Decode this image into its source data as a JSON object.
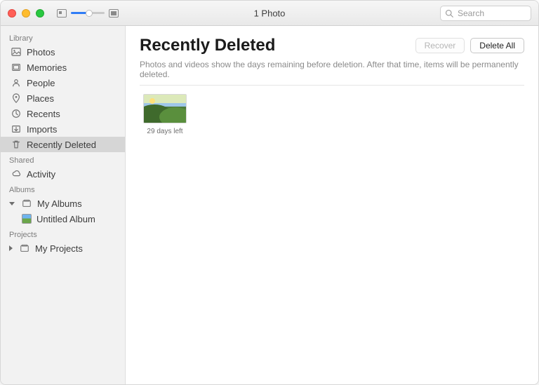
{
  "window": {
    "title": "1 Photo"
  },
  "search": {
    "placeholder": "Search"
  },
  "sidebar": {
    "sections": {
      "library": {
        "header": "Library",
        "items": [
          {
            "label": "Photos"
          },
          {
            "label": "Memories"
          },
          {
            "label": "People"
          },
          {
            "label": "Places"
          },
          {
            "label": "Recents"
          },
          {
            "label": "Imports"
          },
          {
            "label": "Recently Deleted"
          }
        ]
      },
      "shared": {
        "header": "Shared",
        "items": [
          {
            "label": "Activity"
          }
        ]
      },
      "albums": {
        "header": "Albums",
        "items": [
          {
            "label": "My Albums"
          },
          {
            "label": "Untitled Album"
          }
        ]
      },
      "projects": {
        "header": "Projects",
        "items": [
          {
            "label": "My Projects"
          }
        ]
      }
    }
  },
  "main": {
    "heading": "Recently Deleted",
    "recover_label": "Recover",
    "delete_all_label": "Delete All",
    "subtext": "Photos and videos show the days remaining before deletion. After that time, items will be permanently deleted."
  },
  "items": [
    {
      "caption": "29 days left"
    }
  ]
}
